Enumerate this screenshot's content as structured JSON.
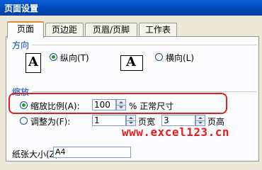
{
  "window": {
    "title": "页面设置"
  },
  "tabs": [
    {
      "label": "页面",
      "active": true
    },
    {
      "label": "页边距",
      "active": false
    },
    {
      "label": "页眉/页脚",
      "active": false
    },
    {
      "label": "工作表",
      "active": false
    }
  ],
  "orientation": {
    "section_label": "方向",
    "portrait_label": "纵向(T)",
    "landscape_label": "横向(L)",
    "selected": "portrait",
    "icon_letter": "A"
  },
  "scaling": {
    "section_label": "缩放",
    "zoom_label": "缩放比例(A):",
    "zoom_value": "100",
    "zoom_suffix": "% 正常尺寸",
    "fit_label": "调整为(F):",
    "fit_wide_value": "1",
    "fit_wide_unit": "页宽",
    "fit_tall_value": "3",
    "fit_tall_unit": "页高",
    "selected": "zoom"
  },
  "paper": {
    "size_label": "纸张大小(Z):",
    "size_value": "A4"
  },
  "watermark": "www.excel123.cn",
  "colors": {
    "highlight": "#e02020",
    "title_bar": "#0047b8",
    "watermark": "#e81c1c"
  }
}
